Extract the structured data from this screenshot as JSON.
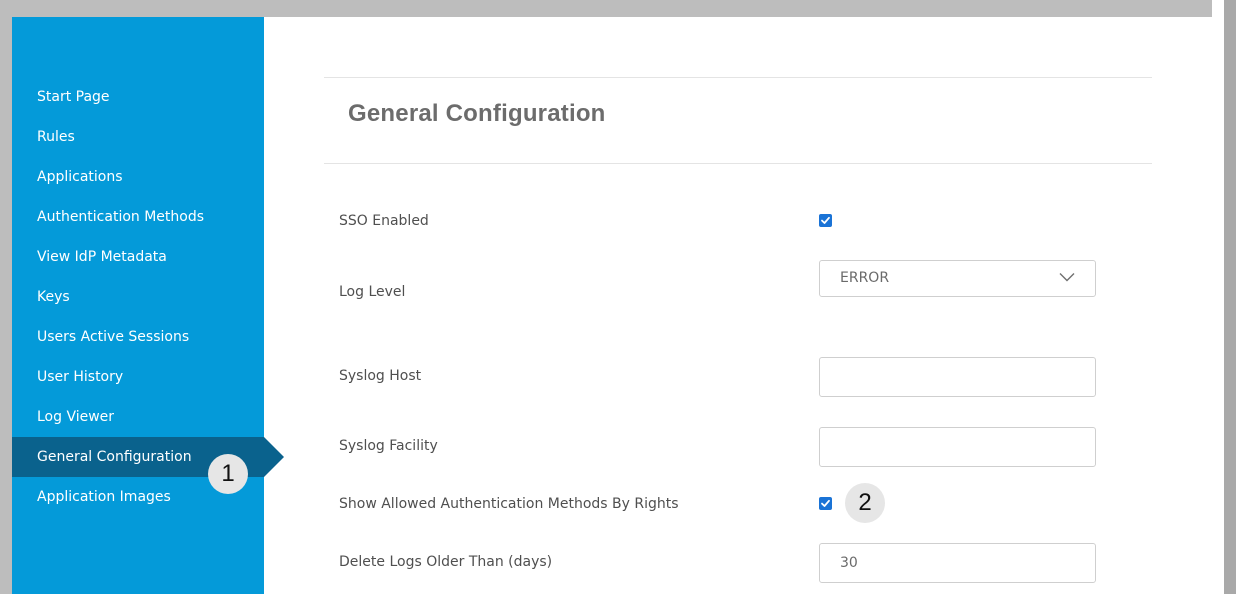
{
  "sidebar": {
    "items": [
      {
        "label": "Start Page",
        "active": false
      },
      {
        "label": "Rules",
        "active": false
      },
      {
        "label": "Applications",
        "active": false
      },
      {
        "label": "Authentication Methods",
        "active": false
      },
      {
        "label": "View IdP Metadata",
        "active": false
      },
      {
        "label": "Keys",
        "active": false
      },
      {
        "label": "Users Active Sessions",
        "active": false
      },
      {
        "label": "User History",
        "active": false
      },
      {
        "label": "Log Viewer",
        "active": false
      },
      {
        "label": "General Configuration",
        "active": true
      },
      {
        "label": "Application Images",
        "active": false
      }
    ]
  },
  "callouts": {
    "one": "1",
    "two": "2"
  },
  "main": {
    "title": "General Configuration",
    "fields": {
      "sso_enabled": {
        "label": "SSO Enabled",
        "checked": true
      },
      "log_level": {
        "label": "Log Level",
        "value": "ERROR"
      },
      "syslog_host": {
        "label": "Syslog Host",
        "value": ""
      },
      "syslog_facility": {
        "label": "Syslog Facility",
        "value": ""
      },
      "show_allowed": {
        "label": "Show Allowed Authentication Methods By Rights",
        "checked": true
      },
      "delete_logs": {
        "label": "Delete Logs Older Than (days)",
        "value": "30"
      }
    }
  },
  "colors": {
    "sidebar_bg": "#049ad9",
    "sidebar_active": "#0a628d",
    "checkbox": "#1a73d6"
  }
}
